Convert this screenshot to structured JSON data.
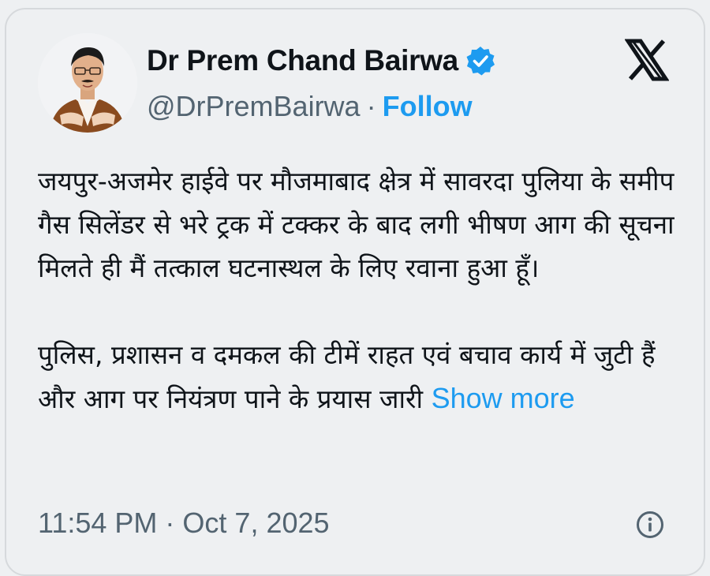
{
  "author": {
    "display_name": "Dr Prem Chand Bairwa",
    "handle": "@DrPremBairwa",
    "separator": "·",
    "follow_label": "Follow",
    "verified_icon": "verified-badge-icon",
    "avatar": "profile-photo"
  },
  "platform_icon": "x-logo-icon",
  "post": {
    "paragraph_1": "जयपुर-अजमेर हाईवे पर मौजमाबाद क्षेत्र में  सावरदा पुलिया के समीप गैस सिलेंडर से भरे ट्रक में टक्कर के बाद लगी भीषण आग की सूचना मिलते ही मैं तत्काल घटनास्थल के लिए रवाना हुआ हूँ।",
    "paragraph_2": "पुलिस, प्रशासन व दमकल की टीमें राहत एवं बचाव कार्य में जुटी हैं और आग पर नियंत्रण पाने के प्रयास जारी",
    "show_more_label": "Show more"
  },
  "footer": {
    "timestamp": "11:54 PM · Oct 7, 2025",
    "info_icon": "info-icon"
  },
  "colors": {
    "background": "#eef0f2",
    "accent": "#1d9bf0",
    "text": "#0f1419",
    "secondary_text": "#536471"
  }
}
